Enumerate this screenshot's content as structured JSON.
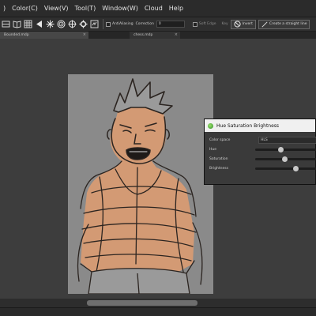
{
  "menubar": {
    "items": [
      ")",
      "Color(C)",
      "View(V)",
      "Tool(T)",
      "Window(W)",
      "Cloud",
      "Help"
    ]
  },
  "toolbar": {
    "antialiasing_label": "AntiAliasing",
    "correction_label": "Correction",
    "correction_value": "0",
    "soft_edge_label": "Soft Edge",
    "key_label": "Key",
    "invert_label": "Invert",
    "straight_line_label": "Create a straight line"
  },
  "tabs": [
    {
      "label": "Bounded.mdp"
    },
    {
      "label": "chess.mdp"
    }
  ],
  "dialog": {
    "title": "Hue Saturation Brightness",
    "color_space_label": "Color space",
    "color_space_value": "HLS",
    "hue_label": "Hue",
    "saturation_label": "Saturation",
    "brightness_label": "Brightness",
    "hue_value": 0.38,
    "saturation_value": 0.44,
    "brightness_value": 0.62
  },
  "colors": {
    "skin": "#d39a74",
    "paper": "#8a8a8a",
    "sketch_line": "#2b2420",
    "canvas_bg": "#3d3d3d"
  }
}
